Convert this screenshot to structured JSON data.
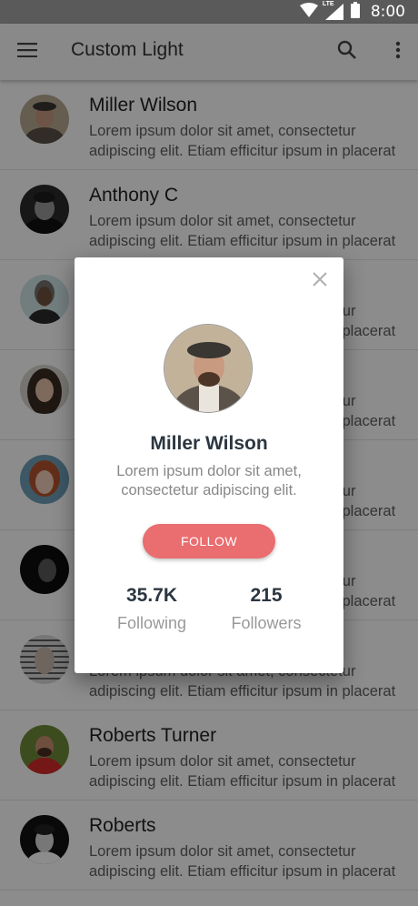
{
  "status_bar": {
    "network_label": "LTE",
    "time": "8:00"
  },
  "app_bar": {
    "title": "Custom Light",
    "icons": [
      "menu-icon",
      "search-icon",
      "more-vert-icon"
    ]
  },
  "list": {
    "items": [
      {
        "name": "Miller Wilson",
        "line1": "Lorem ipsum dolor sit amet, consectetur",
        "line2": "adipiscing elit. Etiam efficitur ipsum in placerat"
      },
      {
        "name": "Anthony C",
        "line1": "Lorem ipsum dolor sit amet, consectetur",
        "line2": "adipiscing elit. Etiam efficitur ipsum in placerat"
      },
      {
        "name": "",
        "line1": "Lorem ipsum dolor sit amet, consectetur",
        "line2": "adipiscing elit. Etiam efficitur ipsum in placerat"
      },
      {
        "name": "",
        "line1": "Lorem ipsum dolor sit amet, consectetur",
        "line2": "adipiscing elit. Etiam efficitur ipsum in placerat"
      },
      {
        "name": "",
        "line1": "Lorem ipsum dolor sit amet, consectetur",
        "line2": "adipiscing elit. Etiam efficitur ipsum in placerat"
      },
      {
        "name": "",
        "line1": "Lorem ipsum dolor sit amet, consectetur",
        "line2": "adipiscing elit. Etiam efficitur ipsum in placerat"
      },
      {
        "name": "",
        "line1": "Lorem ipsum dolor sit amet, consectetur",
        "line2": "adipiscing elit. Etiam efficitur ipsum in placerat"
      },
      {
        "name": "Roberts Turner",
        "line1": "Lorem ipsum dolor sit amet, consectetur",
        "line2": "adipiscing elit. Etiam efficitur ipsum in placerat"
      },
      {
        "name": "Roberts",
        "line1": "Lorem ipsum dolor sit amet, consectetur",
        "line2": "adipiscing elit. Etiam efficitur ipsum in placerat"
      }
    ]
  },
  "dialog": {
    "name": "Miller Wilson",
    "desc_line1": "Lorem ipsum dolor sit amet,",
    "desc_line2": "consectetur adipiscing elit.",
    "follow_label": "FOLLOW",
    "stats": [
      {
        "value": "35.7K",
        "label": "Following"
      },
      {
        "value": "215",
        "label": "Followers"
      }
    ]
  },
  "colors": {
    "accent": "#ea6d6f",
    "heading": "#2b3640",
    "status_bar": "#5a5a5a",
    "app_bar": "#fafafa"
  }
}
